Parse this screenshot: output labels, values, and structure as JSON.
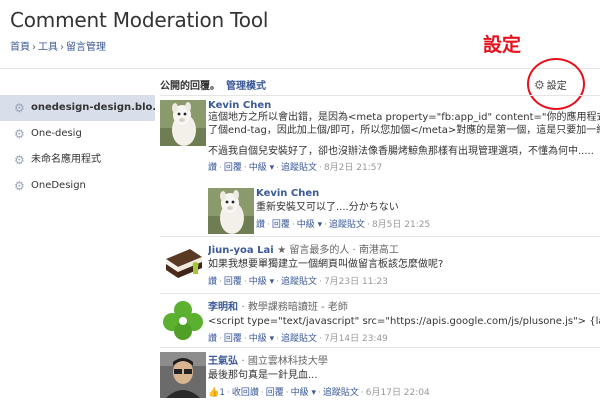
{
  "app": {
    "title": "Comment Moderation Tool"
  },
  "breadcrumb": {
    "items": [
      "首頁",
      "工具",
      "留言管理"
    ]
  },
  "annotation": {
    "label": "設定"
  },
  "sidebar": {
    "items": [
      {
        "label": "onedesign-design.blo..."
      },
      {
        "label": "One-desig"
      },
      {
        "label": "未命名應用程式"
      },
      {
        "label": "OneDesign"
      }
    ]
  },
  "header": {
    "public": "公開的回覆。",
    "manage": "管理模式",
    "settings": "設定"
  },
  "colors": {
    "link": "#3b5998",
    "annotation_red": "#e8101b",
    "sidebar_active": "#d8dfea"
  },
  "comments": [
    {
      "author": "Kevin Chen",
      "badge": "",
      "lines": [
        "這個地方之所以會出錯，是因為<meta property=\"fb:app_id\" content=\"你的應用程式ID\">這",
        "了個end-tag，因此加上個/即可，所以您加個</meta>對應的是第一個，這是只要加一組的原因",
        "",
        "不過我自個兒安裝好了，卻也沒辦法像香腸烤鯨魚那樣有出現管理選項，不懂為何中....."
      ],
      "actions": [
        "讚",
        "回覆",
        "中級 ▾",
        "追蹤貼文"
      ],
      "date": "8月2日 21:57"
    },
    {
      "author": "Kevin Chen",
      "badge": "",
      "lines": [
        "重新安裝又可以了....分かちない"
      ],
      "actions": [
        "讚",
        "回覆",
        "中級 ▾",
        "追蹤貼文"
      ],
      "date": "8月5日 21:25"
    },
    {
      "author": "Jiun-yoa Lai",
      "badge": "★ 留言最多的人 · 南港高工",
      "lines": [
        "如果我想要單獨建立一個網頁叫做留言板該怎麼做呢?"
      ],
      "actions": [
        "讚",
        "回覆",
        "中級 ▾",
        "追蹤貼文"
      ],
      "date": "7月23日 11:23"
    },
    {
      "author": "李明和",
      "badge": "· 教學課務暗讀班 - 老師",
      "lines": [
        "<script type=\"text/javascript\" src=\"https://apis.google.com/js/plusone.js\"> {lang: 'zh-TW'}"
      ],
      "actions": [
        "讚",
        "回覆",
        "中級 ▾",
        "追蹤貼文"
      ],
      "date": "7月14日 23:49"
    },
    {
      "author": "王氣弘",
      "badge": "· 國立雲林科技大學",
      "lines": [
        "最後那句真是一針見血..."
      ],
      "actions": [
        "1",
        "收回讚",
        "回覆",
        "中級 ▾",
        "追蹤貼文"
      ],
      "date": "6月17日 22:04"
    }
  ]
}
